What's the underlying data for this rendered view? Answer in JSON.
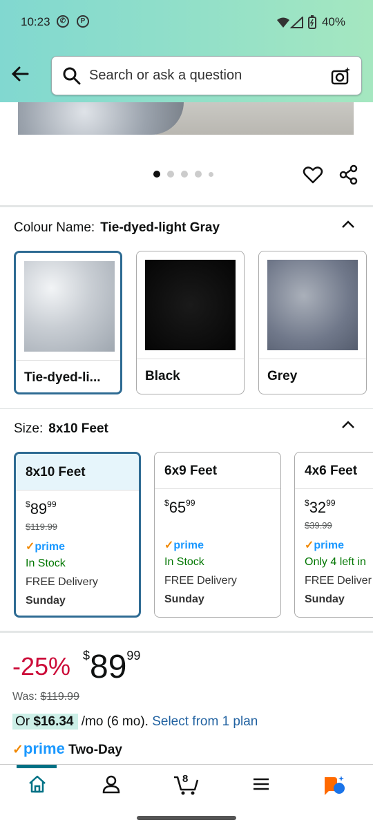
{
  "status_bar": {
    "time": "10:23",
    "battery": "40%"
  },
  "search": {
    "placeholder": "Search or ask a question"
  },
  "colour": {
    "label": "Colour Name:",
    "value": "Tie-dyed-light Gray",
    "options": [
      {
        "name": "Tie-dyed-li...",
        "selected": true
      },
      {
        "name": "Black",
        "selected": false
      },
      {
        "name": "Grey",
        "selected": false
      }
    ]
  },
  "size": {
    "label": "Size:",
    "value": "8x10 Feet",
    "options": [
      {
        "name": "8x10 Feet",
        "price_currency": "$",
        "price_whole": "89",
        "price_cents": "99",
        "was": "$119.99",
        "prime": "prime",
        "stock": "In Stock",
        "delivery": "FREE Delivery",
        "day": "Sunday",
        "selected": true
      },
      {
        "name": "6x9 Feet",
        "price_currency": "$",
        "price_whole": "65",
        "price_cents": "99",
        "was": "",
        "prime": "prime",
        "stock": "In Stock",
        "delivery": "FREE Delivery",
        "day": "Sunday",
        "selected": false
      },
      {
        "name": "4x6 Feet",
        "price_currency": "$",
        "price_whole": "32",
        "price_cents": "99",
        "was": "$39.99",
        "prime": "prime",
        "stock": "Only 4 left in",
        "delivery": "FREE Deliver",
        "day": "Sunday",
        "selected": false
      }
    ]
  },
  "pricing": {
    "discount": "-25%",
    "currency": "$",
    "whole": "89",
    "cents": "99",
    "was_label": "Was:",
    "was_value": "$119.99",
    "monthly_prefix": "Or",
    "monthly_amount": "$16.34",
    "monthly_suffix": "/mo (6 mo).",
    "monthly_link": "Select from 1 plan",
    "prime_brand": "prime",
    "prime_text": "Two-Day"
  },
  "carousel": {
    "count": 5,
    "active": 0
  },
  "cart": {
    "count": "8"
  },
  "colors": {
    "accent": "#2e6b93",
    "discount": "#cc0c39",
    "prime": "#1a98ff",
    "stock": "#007600",
    "link": "#2162a1"
  }
}
